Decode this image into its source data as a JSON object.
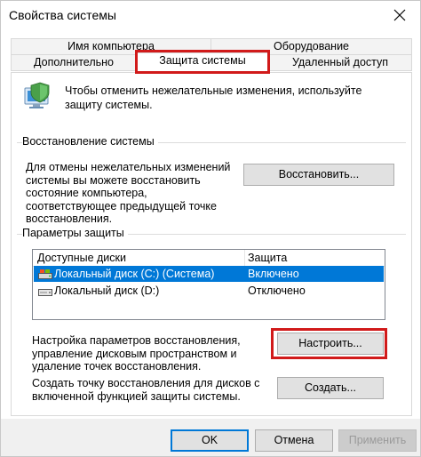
{
  "window": {
    "title": "Свойства системы"
  },
  "tabs": {
    "row1": [
      {
        "label": "Имя компьютера"
      },
      {
        "label": "Оборудование"
      }
    ],
    "row2": [
      {
        "label": "Дополнительно"
      },
      {
        "label": "Защита системы",
        "active": true
      },
      {
        "label": "Удаленный доступ"
      }
    ]
  },
  "intro": {
    "text": "Чтобы отменить нежелательные изменения, используйте защиту системы."
  },
  "restore": {
    "title": "Восстановление системы",
    "description": "Для отмены нежелательных изменений системы вы можете восстановить состояние компьютера, соответствующее предыдущей точке восстановления.",
    "button_label": "Восстановить..."
  },
  "protection": {
    "title": "Параметры защиты",
    "columns": [
      "Доступные диски",
      "Защита"
    ],
    "drives": [
      {
        "name": "Локальный диск (C:) (Система)",
        "state": "Включено",
        "selected": true
      },
      {
        "name": "Локальный диск (D:)",
        "state": "Отключено",
        "selected": false
      }
    ],
    "configure_text": "Настройка параметров восстановления, управление дисковым пространством и удаление точек восстановления.",
    "configure_button": "Настроить...",
    "create_text": "Создать точку восстановления для дисков с включенной функцией защиты системы.",
    "create_button": "Создать..."
  },
  "footer": {
    "ok": "OK",
    "cancel": "Отмена",
    "apply": "Применить"
  },
  "colors": {
    "highlight": "#d11a1a",
    "selection": "#0078d7"
  }
}
